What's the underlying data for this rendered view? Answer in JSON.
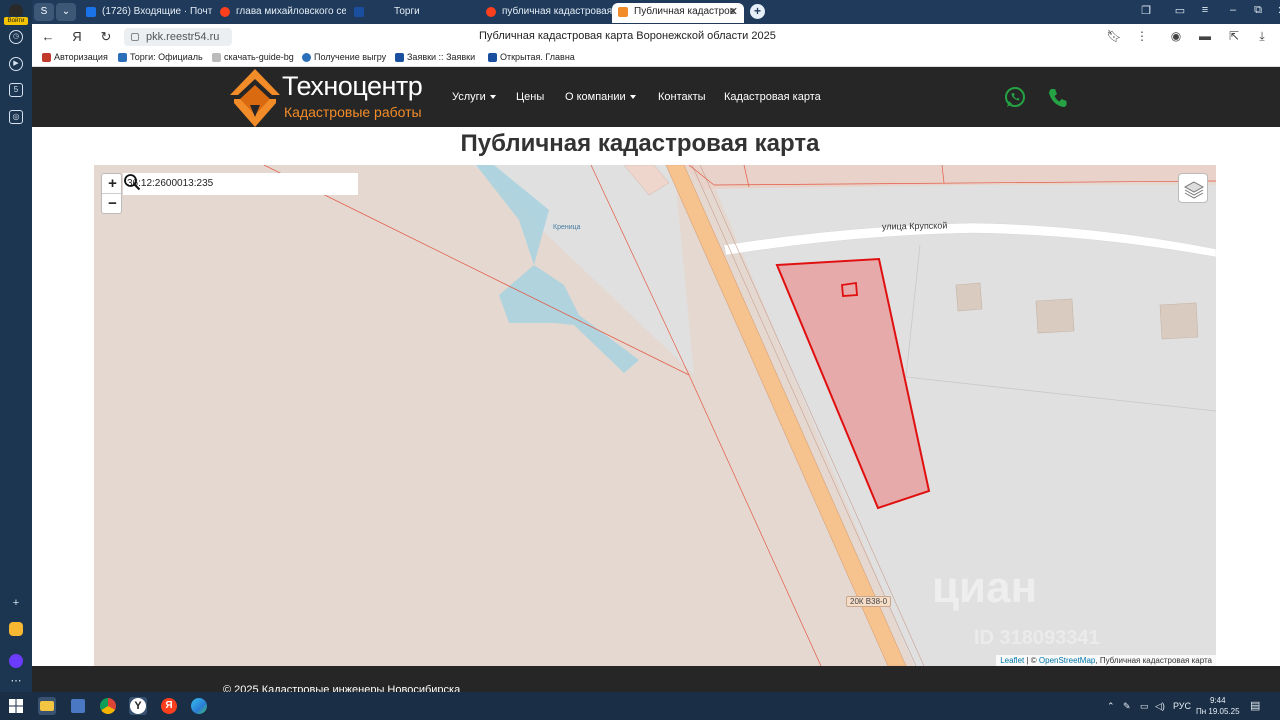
{
  "sidebar": {
    "login_label": "Войти"
  },
  "tabs": [
    {
      "label": "(1726) Входящие · Почта",
      "color": "#1a73e8"
    },
    {
      "label": "глава михайловского сел",
      "color": "#fc3f1d"
    },
    {
      "label": "Торги",
      "color": "#1a4fa0"
    },
    {
      "label": "публичная кадастровая к",
      "color": "#fc3f1d"
    },
    {
      "label": "Публичная кадастров",
      "color": "#f28c28"
    }
  ],
  "address_bar": {
    "url": "pkk.reestr54.ru",
    "page_title": "Публичная кадастровая карта Воронежской области 2025"
  },
  "bookmarks": [
    {
      "label": "Авторизация",
      "color": "#c0392b"
    },
    {
      "label": "Торги: Официаль",
      "color": "#2a6fb8"
    },
    {
      "label": "скачать-guide-bg",
      "color": "#888888"
    },
    {
      "label": "Получение выгру",
      "color": "#2a6fb8"
    },
    {
      "label": "Заявки :: Заявки",
      "color": "#1a4fa0"
    },
    {
      "label": "Открытая. Главна",
      "color": "#1a4fa0"
    }
  ],
  "site": {
    "logo_name": "Техноцентр",
    "logo_sub": "Кадастровые работы",
    "menu": [
      "Услуги",
      "Цены",
      "О компании",
      "Контакты",
      "Кадастровая карта"
    ],
    "title": "Публичная кадастровая карта",
    "footer": "© 2025 Кадастровые инженеры Новосибирска"
  },
  "map": {
    "search_value": "36:12:2600013:235",
    "zoom_in": "+",
    "zoom_out": "−",
    "street_label": "улица Крупской",
    "water_label": "Креница",
    "road_label": "20К В38-0",
    "attribution_leaflet": "Leaflet",
    "attribution_sep": " | © ",
    "attribution_osm": "OpenStreetMap",
    "attribution_rest": ", Публичная кадастровая карта",
    "watermark": "циан",
    "watermark_sub": "ID 318093341",
    "colors": {
      "parcel_fill": "#e8a0a0",
      "parcel_stroke": "#e01010",
      "road": "#f6c28e",
      "water": "#aad3df",
      "land": "#e5d8d1",
      "urban": "#e0e0e0"
    }
  },
  "taskbar": {
    "lang": "РУС",
    "time": "9:44",
    "date": "Пн 19.05.25"
  }
}
